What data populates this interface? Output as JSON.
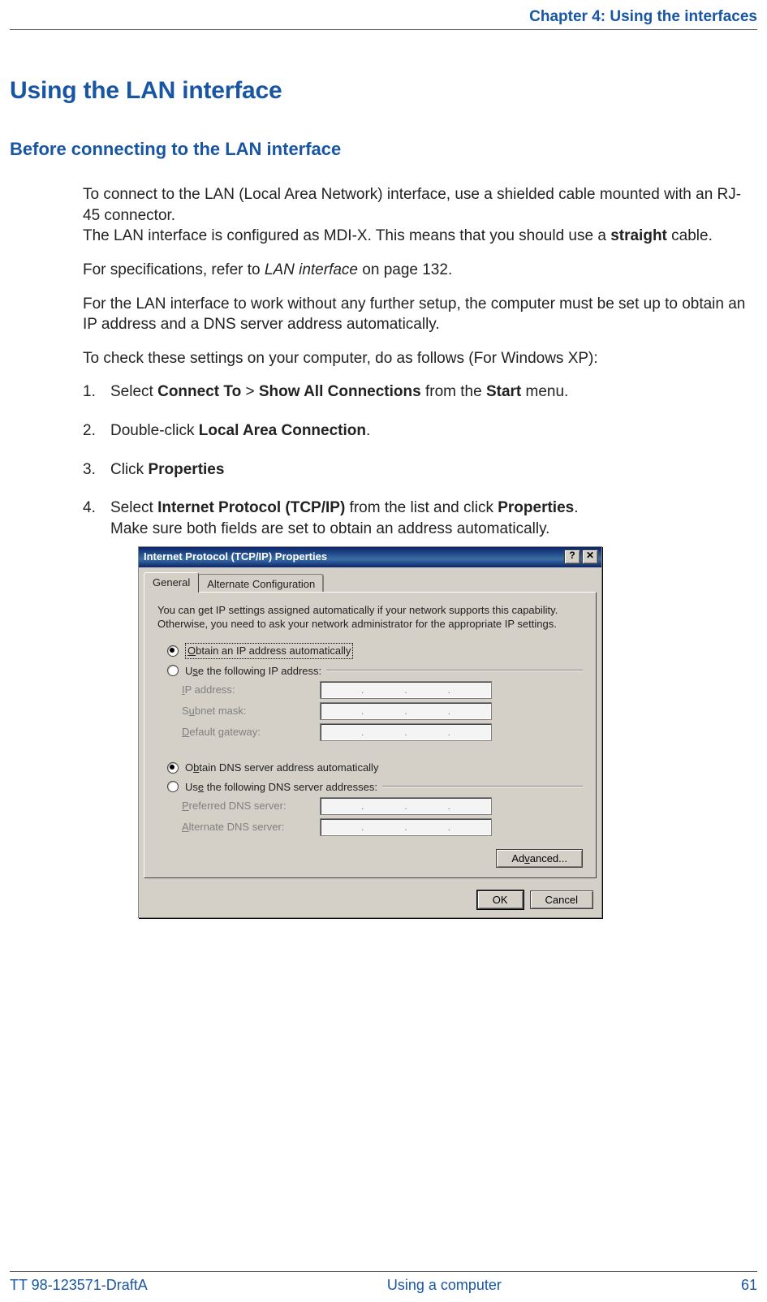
{
  "header": {
    "chapter": "Chapter 4: Using the interfaces"
  },
  "section": {
    "title": "Using the LAN interface",
    "subtitle": "Before connecting to the LAN interface"
  },
  "body": {
    "p1a": "To connect to the LAN (Local Area Network) interface, use a shielded cable mounted with an RJ-45 connector.",
    "p1b_pre": "The LAN interface is configured as MDI-X. This means that you should use a ",
    "p1b_bold": "straight",
    "p1b_post": " cable.",
    "p2_pre": "For specifications, refer to ",
    "p2_italic": "LAN interface",
    "p2_post": " on page 132.",
    "p3": "For the LAN interface to work without any further setup, the computer must be set up to obtain an IP address and a DNS server address automatically.",
    "p4": "To check these settings on your computer, do as follows (For Windows XP):"
  },
  "steps": [
    {
      "parts": [
        {
          "t": "plain",
          "v": "Select "
        },
        {
          "t": "bold",
          "v": "Connect To"
        },
        {
          "t": "plain",
          "v": " > "
        },
        {
          "t": "bold",
          "v": "Show All Connections"
        },
        {
          "t": "plain",
          "v": " from the "
        },
        {
          "t": "bold",
          "v": "Start"
        },
        {
          "t": "plain",
          "v": " menu."
        }
      ]
    },
    {
      "parts": [
        {
          "t": "plain",
          "v": "Double-click "
        },
        {
          "t": "bold",
          "v": "Local Area Connection"
        },
        {
          "t": "plain",
          "v": "."
        }
      ]
    },
    {
      "parts": [
        {
          "t": "plain",
          "v": "Click "
        },
        {
          "t": "bold",
          "v": "Properties"
        }
      ]
    },
    {
      "parts": [
        {
          "t": "plain",
          "v": "Select "
        },
        {
          "t": "bold",
          "v": "Internet Protocol (TCP/IP)"
        },
        {
          "t": "plain",
          "v": " from the list and click "
        },
        {
          "t": "bold",
          "v": "Properties"
        },
        {
          "t": "plain",
          "v": "."
        }
      ],
      "extra": "Make sure both fields are set to obtain an address automatically."
    }
  ],
  "dialog": {
    "title": "Internet Protocol (TCP/IP) Properties",
    "help_btn": "?",
    "close_btn": "✕",
    "tabs": {
      "general": "General",
      "alternate": "Alternate Configuration"
    },
    "desc": "You can get IP settings assigned automatically if your network supports this capability. Otherwise, you need to ask your network administrator for the appropriate IP settings.",
    "radio_auto_ip": "Obtain an IP address automatically",
    "radio_manual_ip": "Use the following IP address:",
    "ip_label": "IP address:",
    "subnet_label": "Subnet mask:",
    "gateway_label": "Default gateway:",
    "radio_auto_dns": "Obtain DNS server address automatically",
    "radio_manual_dns": "Use the following DNS server addresses:",
    "pref_dns_label": "Preferred DNS server:",
    "alt_dns_label": "Alternate DNS server:",
    "advanced_btn": "Advanced...",
    "ok_btn": "OK",
    "cancel_btn": "Cancel"
  },
  "footer": {
    "left": "TT 98-123571-DraftA",
    "center": "Using a computer",
    "right": "61"
  }
}
